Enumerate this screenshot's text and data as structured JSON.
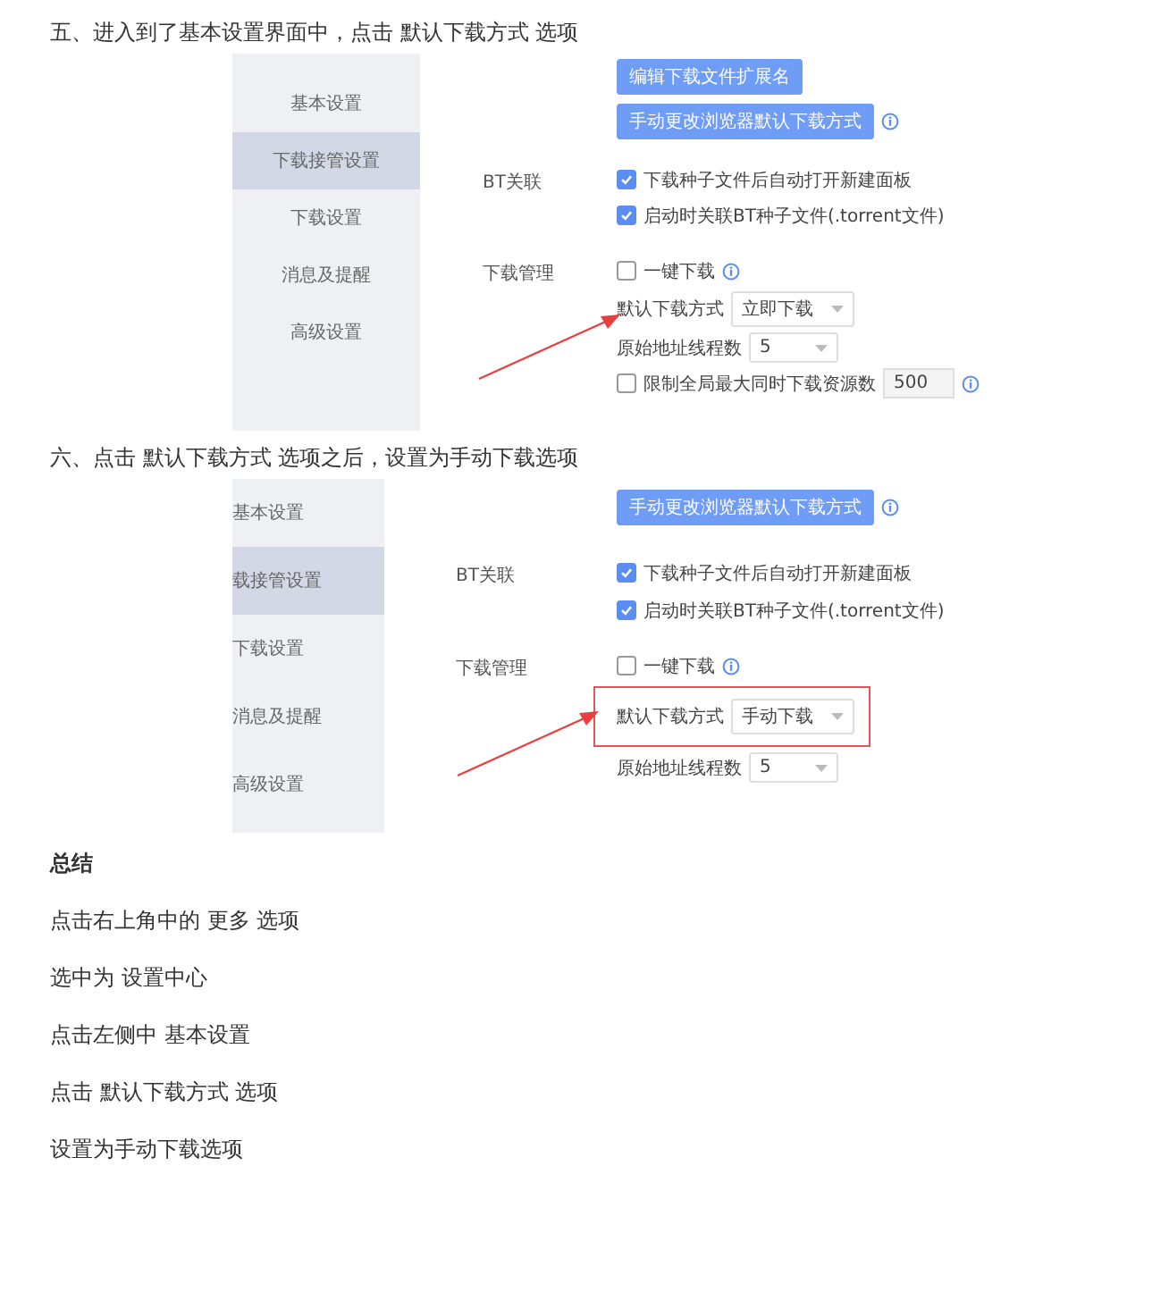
{
  "steps": [
    {
      "heading": "五、进入到了基本设置界面中，点击 默认下载方式 选项",
      "screenshot": {
        "sidebar": [
          {
            "label": "基本设置",
            "selected": false
          },
          {
            "label": "下载接管设置",
            "selected": true
          },
          {
            "label": "下载设置",
            "selected": false
          },
          {
            "label": "消息及提醒",
            "selected": false
          },
          {
            "label": "高级设置",
            "selected": false
          }
        ],
        "buttons": [
          {
            "label": "编辑下载文件扩展名",
            "info": false
          },
          {
            "label": "手动更改浏览器默认下载方式",
            "info": true
          }
        ],
        "groups": [
          {
            "label": "BT关联",
            "rows": [
              {
                "kind": "checkbox",
                "label": "下载种子文件后自动打开新建面板",
                "checked": true,
                "info": false
              },
              {
                "kind": "checkbox",
                "label": "启动时关联BT种子文件(.torrent文件)",
                "checked": true,
                "info": false
              }
            ]
          },
          {
            "label": "下载管理",
            "rows": [
              {
                "kind": "checkbox",
                "label": "一键下载",
                "checked": false,
                "info": true
              },
              {
                "kind": "select",
                "label": "默认下载方式",
                "value": "立即下载",
                "highlighted": false,
                "arrow": true
              },
              {
                "kind": "select",
                "label": "原始地址线程数",
                "value": "5",
                "highlighted": false,
                "arrow": false
              },
              {
                "kind": "checkbox",
                "label": "限制全局最大同时下载资源数",
                "checked": false,
                "info": true,
                "input": "500"
              }
            ]
          }
        ]
      }
    },
    {
      "heading": "六、点击 默认下载方式 选项之后，设置为手动下载选项",
      "screenshot": {
        "sidebar": [
          {
            "label": "基本设置",
            "selected": false
          },
          {
            "label": "载接管设置",
            "selected": true
          },
          {
            "label": "下载设置",
            "selected": false
          },
          {
            "label": "消息及提醒",
            "selected": false
          },
          {
            "label": "高级设置",
            "selected": false
          }
        ],
        "buttons": [
          {
            "label": "手动更改浏览器默认下载方式",
            "info": true
          }
        ],
        "groups": [
          {
            "label": "BT关联",
            "rows": [
              {
                "kind": "checkbox",
                "label": "下载种子文件后自动打开新建面板",
                "checked": true,
                "info": false
              },
              {
                "kind": "checkbox",
                "label": "启动时关联BT种子文件(.torrent文件)",
                "checked": true,
                "info": false
              }
            ]
          },
          {
            "label": "下载管理",
            "rows": [
              {
                "kind": "checkbox",
                "label": "一键下载",
                "checked": false,
                "info": true
              },
              {
                "kind": "select",
                "label": "默认下载方式",
                "value": "手动下载",
                "highlighted": true,
                "arrow": true
              },
              {
                "kind": "select",
                "label": "原始地址线程数",
                "value": "5",
                "highlighted": false,
                "arrow": false
              }
            ]
          }
        ]
      }
    }
  ],
  "summary": {
    "title": "总结",
    "lines": [
      "点击右上角中的 更多 选项",
      "选中为 设置中心",
      "点击左侧中 基本设置",
      "点击 默认下载方式 选项",
      "设置为手动下载选项"
    ]
  }
}
